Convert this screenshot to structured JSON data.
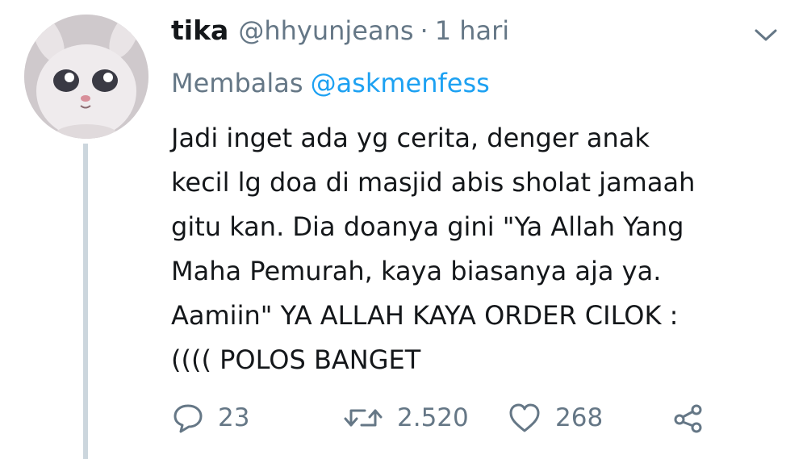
{
  "tweet": {
    "name": "tika",
    "handle": "@hhyunjeans",
    "separator": "·",
    "time": "1 hari",
    "replying_label": "Membalas",
    "replying_to": "@askmenfess",
    "text_lines": [
      "Jadi inget ada yg cerita, denger anak",
      "kecil lg doa di masjid abis sholat jamaah",
      "gitu kan. Dia doanya gini \"Ya Allah Yang",
      "Maha Pemurah, kaya biasanya aja ya.",
      "Aamiin\" YA ALLAH KAYA ORDER CILOK :",
      "(((( POLOS BANGET"
    ],
    "actions": {
      "reply_count": "23",
      "retweet_count": "2.520",
      "like_count": "268"
    }
  },
  "icons": {
    "avatar": "bunny-avatar",
    "caret": "chevron-down-icon",
    "reply": "comment-icon",
    "retweet": "retweet-icon",
    "like": "heart-icon",
    "share": "share-icon"
  },
  "colors": {
    "text": "#14171a",
    "muted": "#657786",
    "link": "#1da1f2",
    "thread_line": "#ccd6dd"
  }
}
